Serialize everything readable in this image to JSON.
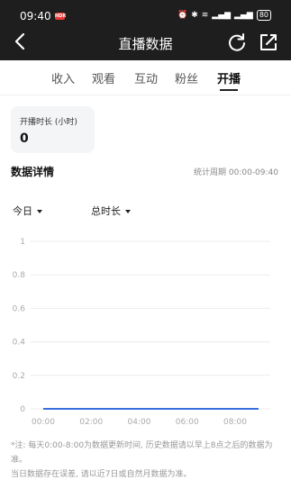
{
  "status_bar": {
    "time": "09:40",
    "hdr_badge": "HDR",
    "battery": "80"
  },
  "header": {
    "title": "直播数据"
  },
  "tabs": [
    {
      "label": "收入",
      "active": false
    },
    {
      "label": "观看",
      "active": false
    },
    {
      "label": "互动",
      "active": false
    },
    {
      "label": "粉丝",
      "active": false
    },
    {
      "label": "开播",
      "active": true
    }
  ],
  "metric_card": {
    "label": "开播时长 (小时)",
    "value": "0"
  },
  "details": {
    "title": "数据详情",
    "period": "统计周期 00:00-09:40"
  },
  "filters": {
    "date": "今日",
    "metric": "总时长"
  },
  "chart_data": {
    "type": "line",
    "x": [
      "00:00",
      "09:40"
    ],
    "xticks": [
      "00:00",
      "02:00",
      "04:00",
      "06:00",
      "08:00"
    ],
    "y": [
      0,
      0
    ],
    "yticks": [
      "0",
      "0.2",
      "0.4",
      "0.6",
      "0.8",
      "1"
    ],
    "ylim": [
      0,
      1
    ],
    "grid": true,
    "line_color": "#3b6fe0"
  },
  "note": {
    "line1": "*注: 每天0:00-8:00为数据更新时间, 历史数据请以早上8点之后的数据为准。",
    "line2": "当日数据存在误差, 请以近7日或自然月数据为准。"
  }
}
